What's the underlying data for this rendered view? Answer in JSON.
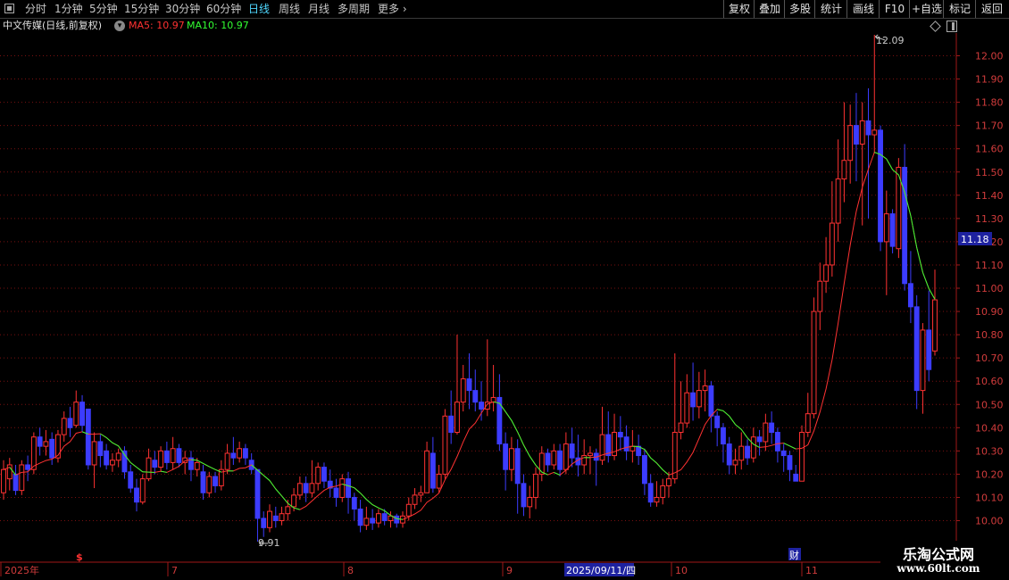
{
  "toolbar": {
    "periods": [
      "分时",
      "1分钟",
      "5分钟",
      "15分钟",
      "30分钟",
      "60分钟",
      "日线",
      "周线",
      "月线",
      "多周期",
      "更多"
    ],
    "active_period": "日线",
    "right_buttons": [
      "复权",
      "叠加",
      "多股",
      "统计",
      "画线",
      "F10",
      "+自选",
      "标记",
      "返回"
    ]
  },
  "info": {
    "stock": "中文传媒(日线,前复权)",
    "ma5_label": "MA5: 10.97",
    "ma10_label": "MA10: 10.97"
  },
  "colors": {
    "up": "#ff3232",
    "down": "#3c3cff",
    "ma5": "#ff3232",
    "ma10": "#32ff32",
    "grid": "#7a1010",
    "axis_text": "#d23c3c",
    "price_tag_bg": "#1e22a0"
  },
  "chart_data": {
    "type": "candlestick",
    "y_ticks": [
      10.0,
      10.1,
      10.2,
      10.3,
      10.4,
      10.5,
      10.6,
      10.7,
      10.8,
      10.9,
      11.0,
      11.1,
      11.2,
      11.3,
      11.4,
      11.5,
      11.6,
      11.7,
      11.8,
      11.9,
      12.0
    ],
    "ylim": [
      9.95,
      12.1
    ],
    "current_price": "11.18",
    "high_label": "12.09",
    "low_label": "9.91",
    "x_labels": [
      "2025年",
      "7",
      "8",
      "9",
      "10",
      "11"
    ],
    "cursor_date": "2025/09/11/四",
    "markers": {
      "dividend": "$",
      "finance": "财"
    },
    "candles": [
      [
        10.12,
        10.22,
        10.26,
        10.09
      ],
      [
        10.18,
        10.24,
        10.27,
        10.13
      ],
      [
        10.2,
        10.13,
        10.24,
        10.11
      ],
      [
        10.13,
        10.24,
        10.26,
        10.11
      ],
      [
        10.24,
        10.22,
        10.28,
        10.17
      ],
      [
        10.22,
        10.36,
        10.38,
        10.2
      ],
      [
        10.36,
        10.32,
        10.4,
        10.28
      ],
      [
        10.32,
        10.34,
        10.39,
        10.28
      ],
      [
        10.35,
        10.27,
        10.38,
        10.24
      ],
      [
        10.27,
        10.37,
        10.39,
        10.25
      ],
      [
        10.37,
        10.44,
        10.47,
        10.34
      ],
      [
        10.44,
        10.4,
        10.49,
        10.36
      ],
      [
        10.41,
        10.51,
        10.56,
        10.4
      ],
      [
        10.51,
        10.41,
        10.54,
        10.38
      ],
      [
        10.48,
        10.24,
        10.48,
        10.22
      ],
      [
        10.24,
        10.34,
        10.38,
        10.14
      ],
      [
        10.34,
        10.28,
        10.37,
        10.23
      ],
      [
        10.3,
        10.24,
        10.33,
        10.22
      ],
      [
        10.24,
        10.26,
        10.29,
        10.21
      ],
      [
        10.26,
        10.29,
        10.31,
        10.23
      ],
      [
        10.3,
        10.21,
        10.32,
        10.18
      ],
      [
        10.21,
        10.14,
        10.24,
        10.12
      ],
      [
        10.14,
        10.08,
        10.18,
        10.04
      ],
      [
        10.08,
        10.18,
        10.2,
        10.07
      ],
      [
        10.18,
        10.27,
        10.31,
        10.17
      ],
      [
        10.26,
        10.23,
        10.3,
        10.2
      ],
      [
        10.23,
        10.3,
        10.32,
        10.21
      ],
      [
        10.3,
        10.25,
        10.34,
        10.22
      ],
      [
        10.25,
        10.31,
        10.36,
        10.22
      ],
      [
        10.31,
        10.25,
        10.33,
        10.23
      ],
      [
        10.25,
        10.27,
        10.3,
        10.2
      ],
      [
        10.27,
        10.22,
        10.3,
        10.17
      ],
      [
        10.22,
        10.25,
        10.27,
        10.19
      ],
      [
        10.21,
        10.12,
        10.24,
        10.09
      ],
      [
        10.12,
        10.19,
        10.21,
        10.1
      ],
      [
        10.19,
        10.15,
        10.21,
        10.12
      ],
      [
        10.15,
        10.22,
        10.26,
        10.13
      ],
      [
        10.22,
        10.29,
        10.33,
        10.2
      ],
      [
        10.29,
        10.27,
        10.36,
        10.24
      ],
      [
        10.27,
        10.31,
        10.34,
        10.25
      ],
      [
        10.31,
        10.27,
        10.33,
        10.24
      ],
      [
        10.26,
        10.22,
        10.29,
        10.2
      ],
      [
        10.22,
        10.01,
        10.22,
        9.91
      ],
      [
        10.01,
        9.97,
        10.04,
        9.93
      ],
      [
        9.97,
        10.04,
        10.07,
        9.95
      ],
      [
        10.02,
        10.0,
        10.06,
        9.97
      ],
      [
        10.0,
        10.03,
        10.06,
        9.98
      ],
      [
        10.03,
        10.06,
        10.09,
        10.0
      ],
      [
        10.06,
        10.11,
        10.14,
        10.04
      ],
      [
        10.11,
        10.16,
        10.19,
        10.09
      ],
      [
        10.16,
        10.12,
        10.19,
        10.08
      ],
      [
        10.12,
        10.16,
        10.26,
        10.1
      ],
      [
        10.16,
        10.23,
        10.25,
        10.13
      ],
      [
        10.23,
        10.17,
        10.25,
        10.14
      ],
      [
        10.17,
        10.14,
        10.22,
        10.1
      ],
      [
        10.14,
        10.1,
        10.18,
        10.06
      ],
      [
        10.1,
        10.18,
        10.2,
        10.08
      ],
      [
        10.18,
        10.1,
        10.21,
        10.03
      ],
      [
        10.1,
        10.05,
        10.12,
        10.0
      ],
      [
        10.05,
        9.98,
        10.09,
        9.95
      ],
      [
        9.98,
        10.01,
        10.06,
        9.96
      ],
      [
        10.01,
        9.99,
        10.05,
        9.96
      ],
      [
        9.99,
        10.03,
        10.05,
        9.97
      ],
      [
        10.03,
        10.0,
        10.05,
        9.98
      ],
      [
        10.0,
        10.02,
        10.04,
        9.97
      ],
      [
        10.02,
        9.99,
        10.03,
        9.97
      ],
      [
        9.99,
        10.02,
        10.04,
        9.97
      ],
      [
        10.02,
        10.07,
        10.1,
        10.0
      ],
      [
        10.07,
        10.11,
        10.14,
        10.05
      ],
      [
        10.11,
        10.12,
        10.15,
        10.08
      ],
      [
        10.12,
        10.3,
        10.34,
        10.12
      ],
      [
        10.29,
        10.14,
        10.36,
        10.12
      ],
      [
        10.14,
        10.2,
        10.24,
        10.12
      ],
      [
        10.2,
        10.45,
        10.48,
        10.18
      ],
      [
        10.45,
        10.38,
        10.56,
        10.33
      ],
      [
        10.38,
        10.51,
        10.8,
        10.37
      ],
      [
        10.51,
        10.61,
        10.67,
        10.47
      ],
      [
        10.61,
        10.56,
        10.72,
        10.48
      ],
      [
        10.56,
        10.51,
        10.65,
        10.47
      ],
      [
        10.51,
        10.48,
        10.6,
        10.43
      ],
      [
        10.48,
        10.51,
        10.78,
        10.45
      ],
      [
        10.51,
        10.53,
        10.67,
        10.47
      ],
      [
        10.53,
        10.33,
        10.63,
        10.3
      ],
      [
        10.33,
        10.22,
        10.38,
        10.13
      ],
      [
        10.22,
        10.31,
        10.36,
        10.17
      ],
      [
        10.31,
        10.16,
        10.35,
        10.03
      ],
      [
        10.16,
        10.06,
        10.2,
        10.02
      ],
      [
        10.06,
        10.1,
        10.15,
        10.01
      ],
      [
        10.1,
        10.2,
        10.23,
        10.05
      ],
      [
        10.2,
        10.29,
        10.32,
        10.17
      ],
      [
        10.29,
        10.24,
        10.31,
        10.21
      ],
      [
        10.24,
        10.3,
        10.33,
        10.22
      ],
      [
        10.3,
        10.22,
        10.33,
        10.19
      ],
      [
        10.22,
        10.33,
        10.38,
        10.2
      ],
      [
        10.33,
        10.27,
        10.4,
        10.23
      ],
      [
        10.27,
        10.24,
        10.37,
        10.19
      ],
      [
        10.24,
        10.28,
        10.35,
        10.2
      ],
      [
        10.28,
        10.29,
        10.32,
        10.2
      ],
      [
        10.29,
        10.26,
        10.31,
        10.15
      ],
      [
        10.26,
        10.37,
        10.49,
        10.24
      ],
      [
        10.37,
        10.28,
        10.47,
        10.25
      ],
      [
        10.28,
        10.38,
        10.46,
        10.26
      ],
      [
        10.38,
        10.36,
        10.45,
        10.3
      ],
      [
        10.36,
        10.3,
        10.41,
        10.26
      ],
      [
        10.3,
        10.32,
        10.39,
        10.25
      ],
      [
        10.32,
        10.28,
        10.37,
        10.24
      ],
      [
        10.28,
        10.16,
        10.31,
        10.11
      ],
      [
        10.16,
        10.08,
        10.2,
        10.06
      ],
      [
        10.08,
        10.1,
        10.17,
        10.06
      ],
      [
        10.1,
        10.15,
        10.18,
        10.07
      ],
      [
        10.15,
        10.18,
        10.21,
        10.1
      ],
      [
        10.18,
        10.38,
        10.72,
        10.16
      ],
      [
        10.38,
        10.42,
        10.6,
        10.35
      ],
      [
        10.42,
        10.55,
        10.63,
        10.4
      ],
      [
        10.55,
        10.49,
        10.68,
        10.43
      ],
      [
        10.49,
        10.56,
        10.64,
        10.44
      ],
      [
        10.56,
        10.58,
        10.65,
        10.47
      ],
      [
        10.58,
        10.45,
        10.6,
        10.38
      ],
      [
        10.45,
        10.4,
        10.47,
        10.32
      ],
      [
        10.4,
        10.33,
        10.42,
        10.25
      ],
      [
        10.33,
        10.24,
        10.36,
        10.2
      ],
      [
        10.24,
        10.26,
        10.31,
        10.2
      ],
      [
        10.26,
        10.32,
        10.38,
        10.22
      ],
      [
        10.32,
        10.27,
        10.35,
        10.24
      ],
      [
        10.27,
        10.36,
        10.4,
        10.25
      ],
      [
        10.36,
        10.34,
        10.39,
        10.28
      ],
      [
        10.34,
        10.42,
        10.46,
        10.3
      ],
      [
        10.42,
        10.38,
        10.47,
        10.33
      ],
      [
        10.38,
        10.3,
        10.4,
        10.25
      ],
      [
        10.3,
        10.28,
        10.33,
        10.21
      ],
      [
        10.28,
        10.22,
        10.3,
        10.17
      ],
      [
        10.2,
        10.17,
        10.24,
        10.17
      ],
      [
        10.17,
        10.38,
        10.41,
        10.17
      ],
      [
        10.38,
        10.46,
        10.55,
        10.36
      ],
      [
        10.46,
        10.9,
        10.96,
        10.44
      ],
      [
        10.9,
        11.03,
        11.11,
        10.82
      ],
      [
        11.03,
        11.1,
        11.22,
        10.98
      ],
      [
        11.1,
        11.28,
        11.46,
        11.05
      ],
      [
        11.28,
        11.47,
        11.64,
        11.2
      ],
      [
        11.47,
        11.55,
        11.8,
        11.37
      ],
      [
        11.55,
        11.7,
        11.79,
        11.45
      ],
      [
        11.7,
        11.62,
        11.84,
        11.46
      ],
      [
        11.62,
        11.72,
        11.8,
        11.27
      ],
      [
        11.72,
        11.66,
        11.86,
        11.3
      ],
      [
        11.66,
        11.68,
        12.09,
        11.58
      ],
      [
        11.68,
        11.2,
        11.7,
        11.16
      ],
      [
        11.2,
        11.32,
        11.42,
        10.97
      ],
      [
        11.32,
        11.18,
        11.34,
        11.15
      ],
      [
        11.17,
        11.52,
        11.56,
        11.13
      ],
      [
        11.52,
        11.02,
        11.62,
        10.99
      ],
      [
        11.02,
        10.92,
        11.16,
        10.85
      ],
      [
        10.92,
        10.56,
        10.97,
        10.48
      ],
      [
        10.56,
        10.82,
        10.85,
        10.46
      ],
      [
        10.82,
        10.65,
        10.99,
        10.6
      ],
      [
        10.73,
        10.95,
        11.08,
        10.71
      ]
    ]
  }
}
